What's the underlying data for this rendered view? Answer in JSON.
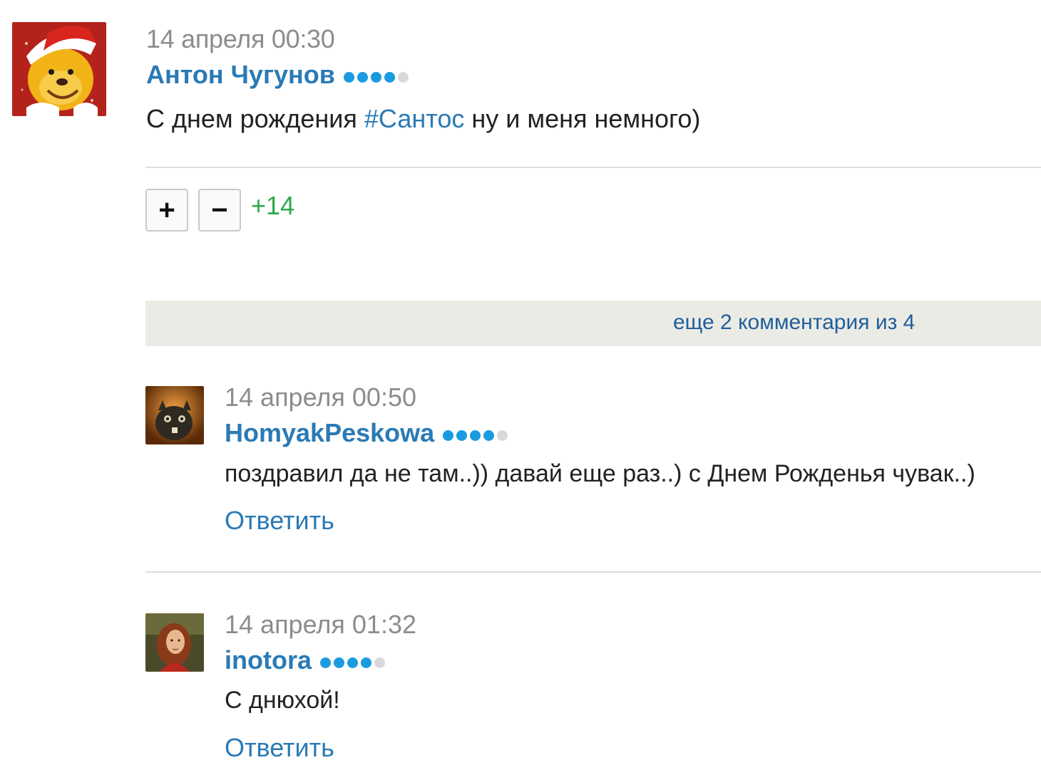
{
  "post": {
    "date": "14 апреля 00:30",
    "author": "Антон Чугунов",
    "author_rating": 4,
    "text_before": "С днем рождения ",
    "hashtag": "#Сантос",
    "text_after": " ну и меня немного)",
    "vote_plus": "+",
    "vote_minus": "−",
    "score": "+14"
  },
  "more_comments": "еще 2 комментария из 4",
  "comments": [
    {
      "date": "14 апреля 00:50",
      "author": "HomyakPeskowa",
      "author_rating": 4,
      "text": "поздравил да не там..)) давай еще раз..) с Днем Рожденья чувак..)",
      "reply_label": "Ответить"
    },
    {
      "date": "14 апреля 01:32",
      "author": "inotora",
      "author_rating": 4,
      "text": "С днюхой!",
      "reply_label": "Ответить"
    }
  ],
  "colors": {
    "link": "#2a7ab5",
    "score_positive": "#2ca84a",
    "rating_on": "#1a9be0",
    "rating_off": "#d9d9d9",
    "more_bar_bg": "#ebebe6"
  }
}
